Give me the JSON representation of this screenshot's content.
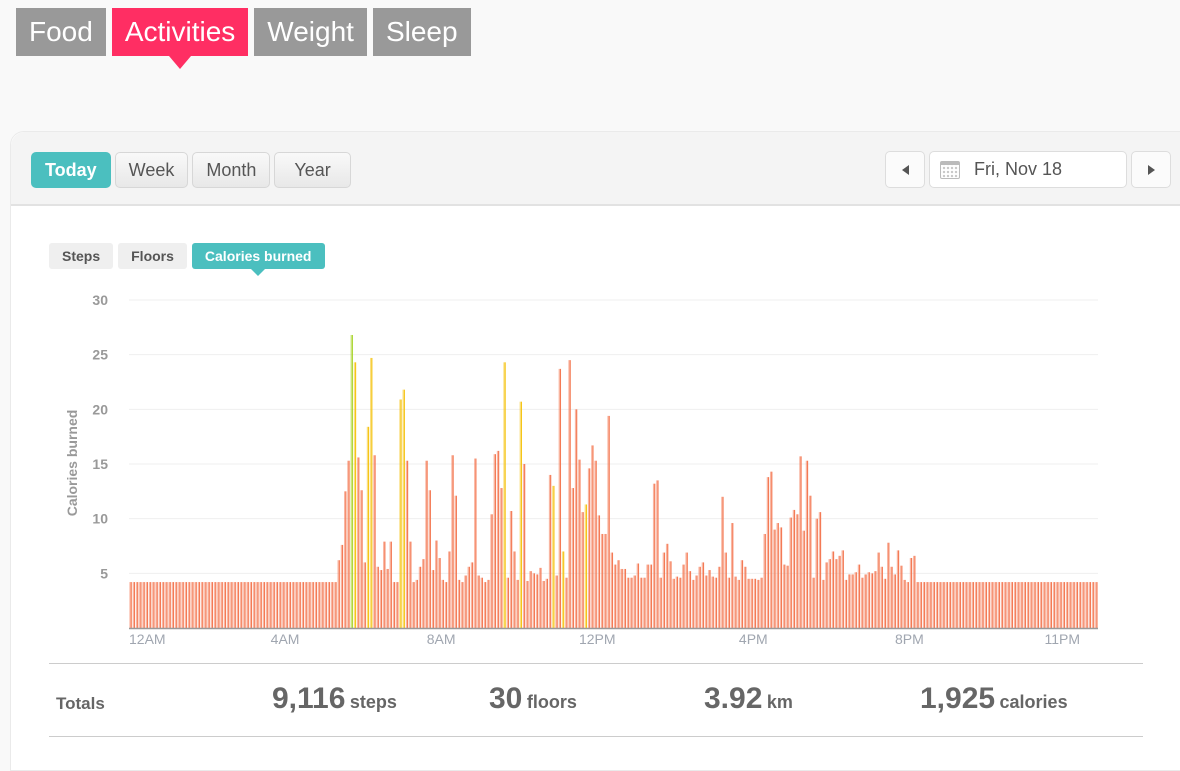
{
  "top_nav": {
    "tabs": [
      {
        "label": "Food",
        "active": false
      },
      {
        "label": "Activities",
        "active": true
      },
      {
        "label": "Weight",
        "active": false
      },
      {
        "label": "Sleep",
        "active": false
      }
    ]
  },
  "range": {
    "buttons": [
      {
        "label": "Today",
        "active": true
      },
      {
        "label": "Week",
        "active": false
      },
      {
        "label": "Month",
        "active": false
      },
      {
        "label": "Year",
        "active": false
      }
    ]
  },
  "date_nav": {
    "prev_icon": "triangle-left",
    "calendar_icon": "calendar",
    "date": "Fri, Nov 18",
    "next_icon": "triangle-right"
  },
  "metric_tabs": [
    {
      "label": "Steps",
      "active": false
    },
    {
      "label": "Floors",
      "active": false
    },
    {
      "label": "Calories burned",
      "active": true
    }
  ],
  "colors": {
    "brand_pink": "#ff2e63",
    "teal": "#4bbfbf",
    "bar_normal": "#f47a55",
    "bar_moderate": "#f5c518",
    "bar_high": "#a8d42a"
  },
  "chart_data": {
    "type": "bar",
    "title": "",
    "xlabel": "",
    "ylabel": "Calories burned",
    "ylim": [
      0,
      30
    ],
    "yticks": [
      5,
      10,
      15,
      20,
      25,
      30
    ],
    "grid": true,
    "x_tick_labels": [
      {
        "label": "12AM",
        "index": 0
      },
      {
        "label": "4AM",
        "index": 48
      },
      {
        "label": "8AM",
        "index": 96
      },
      {
        "label": "12PM",
        "index": 144
      },
      {
        "label": "4PM",
        "index": 192
      },
      {
        "label": "8PM",
        "index": 240
      },
      {
        "label": "11PM",
        "index": 287
      }
    ],
    "interval_minutes": 5,
    "zones_legend": {
      "normal": "#f47a55",
      "moderate": "#f5c518",
      "high": "#a8d42a"
    },
    "values": [
      4.2,
      4.2,
      4.2,
      4.2,
      4.2,
      4.2,
      4.2,
      4.2,
      4.2,
      4.2,
      4.2,
      4.2,
      4.2,
      4.2,
      4.2,
      4.2,
      4.2,
      4.2,
      4.2,
      4.2,
      4.2,
      4.2,
      4.2,
      4.2,
      4.2,
      4.2,
      4.2,
      4.2,
      4.2,
      4.2,
      4.2,
      4.2,
      4.2,
      4.2,
      4.2,
      4.2,
      4.2,
      4.2,
      4.2,
      4.2,
      4.2,
      4.2,
      4.2,
      4.2,
      4.2,
      4.2,
      4.2,
      4.2,
      4.2,
      4.2,
      4.2,
      4.2,
      4.2,
      4.2,
      4.2,
      4.2,
      4.2,
      4.2,
      4.2,
      4.2,
      4.2,
      4.2,
      4.2,
      4.2,
      6.2,
      7.6,
      12.5,
      15.3,
      26.8,
      24.3,
      15.6,
      12.6,
      6.0,
      18.4,
      24.7,
      15.8,
      5.6,
      5.3,
      7.9,
      5.4,
      7.9,
      4.2,
      4.2,
      20.9,
      21.8,
      15.3,
      7.9,
      4.2,
      4.4,
      5.6,
      6.3,
      15.3,
      12.6,
      5.3,
      8.0,
      6.4,
      4.4,
      4.2,
      7.0,
      15.8,
      12.1,
      4.4,
      4.2,
      4.8,
      5.6,
      6.0,
      15.5,
      4.8,
      4.6,
      4.2,
      4.4,
      10.4,
      15.9,
      16.2,
      12.8,
      24.3,
      4.6,
      10.7,
      7.0,
      4.4,
      20.7,
      15.0,
      4.3,
      5.2,
      5.0,
      4.9,
      5.5,
      4.3,
      4.5,
      14.0,
      13.0,
      4.8,
      23.7,
      7.0,
      4.6,
      24.5,
      12.8,
      20.0,
      15.4,
      10.6,
      11.3,
      14.6,
      16.7,
      15.3,
      10.3,
      8.6,
      8.6,
      19.4,
      6.9,
      5.8,
      6.2,
      5.4,
      5.4,
      4.6,
      4.6,
      4.8,
      5.9,
      4.6,
      4.6,
      5.8,
      5.8,
      13.2,
      13.5,
      4.6,
      6.9,
      7.7,
      6.1,
      4.5,
      4.7,
      4.6,
      5.8,
      6.9,
      5.2,
      4.4,
      4.8,
      5.6,
      6.0,
      4.8,
      5.3,
      4.7,
      4.6,
      5.6,
      12.0,
      6.9,
      4.6,
      9.6,
      4.7,
      4.4,
      6.2,
      5.6,
      4.5,
      4.5,
      4.5,
      4.4,
      4.6,
      8.6,
      13.8,
      14.3,
      9.0,
      9.6,
      9.2,
      5.8,
      5.7,
      10.1,
      10.8,
      10.4,
      15.7,
      8.9,
      15.3,
      12.1,
      4.6,
      10.0,
      10.6,
      4.4,
      6.0,
      6.3,
      7.0,
      6.3,
      6.6,
      7.1,
      4.4,
      4.9,
      4.9,
      5.1,
      5.8,
      4.6,
      4.9,
      5.1,
      5.0,
      5.2,
      6.9,
      5.6,
      4.5,
      7.8,
      5.6,
      4.9,
      7.1,
      5.7,
      4.4,
      4.2,
      6.4,
      6.6,
      4.2,
      4.2,
      4.2,
      4.2,
      4.2,
      4.2,
      4.2,
      4.2,
      4.2,
      4.2,
      4.2,
      4.2,
      4.2,
      4.2,
      4.2,
      4.2,
      4.2,
      4.2,
      4.2,
      4.2,
      4.2,
      4.2,
      4.2,
      4.2,
      4.2,
      4.2,
      4.2,
      4.2,
      4.2,
      4.2,
      4.2,
      4.2,
      4.2,
      4.2,
      4.2,
      4.2,
      4.2,
      4.2,
      4.2,
      4.2,
      4.2,
      4.2,
      4.2,
      4.2,
      4.2,
      4.2,
      4.2,
      4.2,
      4.2,
      4.2,
      4.2,
      4.2,
      4.2,
      4.2,
      4.2,
      4.2
    ],
    "zones": {
      "high": [
        68
      ],
      "moderate": [
        69,
        73,
        74,
        83,
        84,
        115,
        120,
        130,
        133,
        140
      ]
    }
  },
  "totals": {
    "label": "Totals",
    "steps": {
      "value": "9,116",
      "unit": "steps"
    },
    "floors": {
      "value": "30",
      "unit": "floors"
    },
    "distance": {
      "value": "3.92",
      "unit": "km"
    },
    "calories": {
      "value": "1,925",
      "unit": "calories"
    }
  }
}
